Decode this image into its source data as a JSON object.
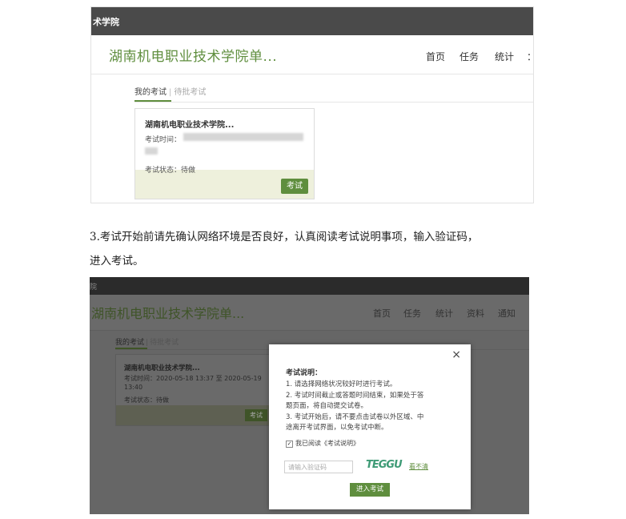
{
  "screenshot1": {
    "topbar_text": "术学院",
    "site_title": "湖南机电职业技术学院单...",
    "nav": [
      "首页",
      "任务",
      "统计",
      "："
    ],
    "tabs": {
      "active": "我的考试",
      "separator": "|",
      "inactive": "待批考试"
    },
    "card": {
      "title": "湖南机电职业技术学院...",
      "time_label": "考试时间：",
      "status": "考试状态：待做",
      "button": "考试"
    }
  },
  "paragraph": {
    "line1": "3.考试开始前请先确认网络环境是否良好，认真阅读考试说明事项，输入验证码，",
    "line2": "进入考试。"
  },
  "screenshot2": {
    "topbar_text": "院",
    "site_title": "湖南机电职业技术学院单...",
    "nav": [
      "首页",
      "任务",
      "统计",
      "资料",
      "通知"
    ],
    "tabs": {
      "active": "我的考试",
      "separator": "|",
      "inactive": "待批考试"
    },
    "card": {
      "title": "湖南机电职业技术学院...",
      "time": "考试时间：2020-05-18 13:37 至 2020-05-19 13:40",
      "status": "考试状态：待做",
      "button": "考试"
    },
    "modal": {
      "close": "×",
      "title": "考试说明：",
      "lines": [
        "1. 请选择网络状况较好时进行考试。",
        "2. 考试时间截止或答题时间结束，如果处于答",
        "题页面，将自动提交试卷。",
        "3. 考试开始后，请不要点击试卷以外区域、中",
        "途离开考试界面，以免考试中断。"
      ],
      "checkbox_label": "我已阅读《考试说明》",
      "captcha_placeholder": "请输入验证码",
      "captcha_text": "TEGGU",
      "refresh_link": "看不清",
      "enter_button": "进入考试"
    }
  }
}
